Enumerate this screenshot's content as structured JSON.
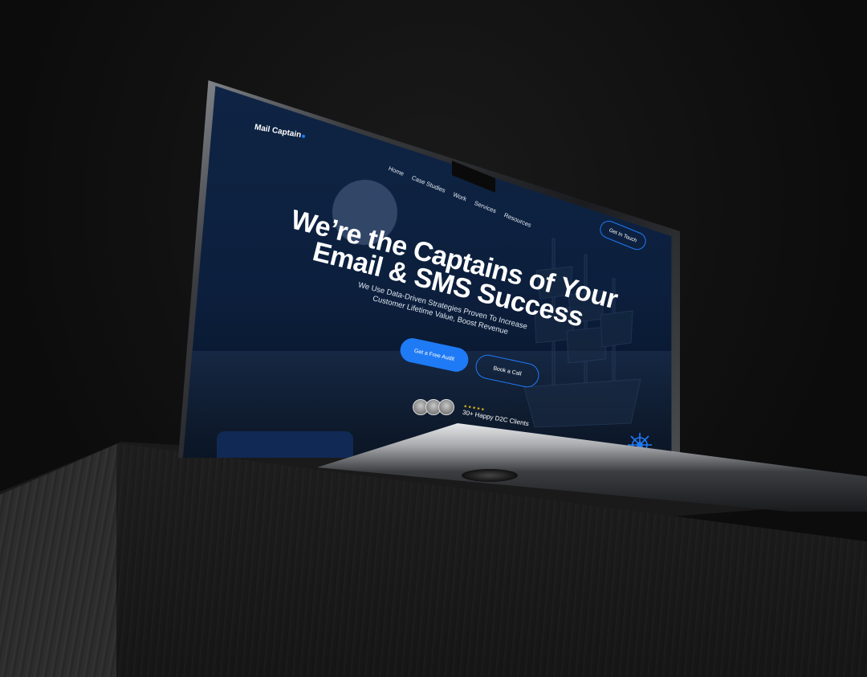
{
  "site": {
    "logo": "Mail Captain",
    "nav": [
      "Home",
      "Case Studies",
      "Work",
      "Services",
      "Resources"
    ],
    "cta_top": "Get In Touch",
    "hero": {
      "title_line1": "We’re the Captains of Your",
      "title_line2": "Email & SMS Success",
      "subtitle_line1": "We Use Data-Driven Strategies Proven To Increase",
      "subtitle_line2": "Customer Lifetime Value, Boost Revenue"
    },
    "primary_button": "Get a Free Audit",
    "secondary_button": "Book a Call",
    "rating_stars": "★★★★★",
    "clients_text": "30+ Happy D2C Clients"
  },
  "colors": {
    "accent": "#1f7af5",
    "background": "#0c1f3d",
    "scene": "#0e0e0e"
  }
}
